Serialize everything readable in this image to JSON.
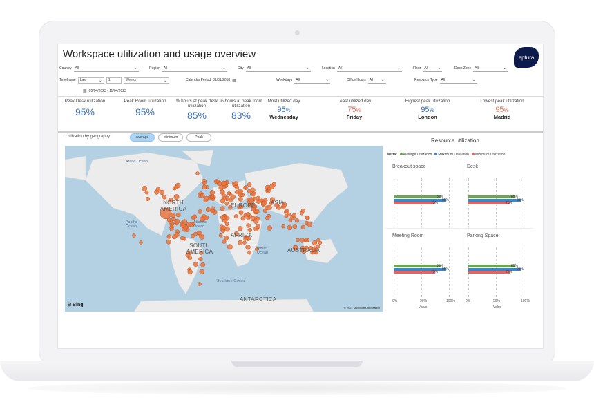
{
  "report": {
    "title": "Workspace utilization and usage overview",
    "logo_text": "eptura"
  },
  "filters": {
    "country": {
      "label": "Country",
      "value": "All"
    },
    "region": {
      "label": "Region",
      "value": "All"
    },
    "city": {
      "label": "City",
      "value": "All"
    },
    "location": {
      "label": "Location",
      "value": "All"
    },
    "floor": {
      "label": "Floor",
      "value": "All"
    },
    "desk_zone": {
      "label": "Desk Zone",
      "value": "All"
    },
    "timeframe": {
      "label": "Timeframe",
      "mode": "Last",
      "count": "1",
      "unit": "Weeks"
    },
    "calendar_period": {
      "label": "Calendar Period",
      "value": "01/01/2018"
    },
    "weekdays": {
      "label": "Weekdays",
      "value": "All"
    },
    "office_hours": {
      "label": "Office Hours",
      "value": "All"
    },
    "resource_type": {
      "label": "Resource Type",
      "value": "All"
    },
    "date_range": "05/04/2023 - 11/04/2023"
  },
  "kpis": [
    {
      "label": "Peak Desk utilization",
      "value": "95%"
    },
    {
      "label": "Peak Room utilization",
      "value": "95%"
    },
    {
      "label": "% hours at peak desk utilization",
      "value": "85%"
    },
    {
      "label": "% hours at peak room utilization",
      "value": "83%"
    },
    {
      "label": "Most utilized day",
      "value": "95",
      "unit": "%",
      "sub": "Wednesday"
    },
    {
      "label": "Least utilized day",
      "value": "75",
      "unit": "%",
      "sub": "Friday"
    },
    {
      "label": "Highest peak utilization",
      "value": "95",
      "unit": "%",
      "sub": "London"
    },
    {
      "label": "Lowest peak utilization",
      "value": "95",
      "unit": "%",
      "sub": "Madrid"
    }
  ],
  "geography": {
    "label": "Utilization by geography:",
    "toggles": [
      "Average",
      "Minimum",
      "Peak"
    ],
    "active": "Average"
  },
  "map": {
    "labels": {
      "arctic": "Arctic Ocean",
      "north_america": "NORTH AMERICA",
      "europe": "EUROPE",
      "asia": "ASIA",
      "africa": "AFRICA",
      "south_america": "SOUTH AMERICA",
      "australia": "AUSTRALIA",
      "antarctica": "ANTARCTICA",
      "atlantic": "Atlantic Ocean",
      "pacific": "Pacific Ocean",
      "indian": "Indian Ocean",
      "southern": "Southern Ocean"
    },
    "bing": "Bing",
    "copyright": "© 2021 Microsoft Corporation",
    "point_color": "#e8763f"
  },
  "resource_utilization": {
    "title": "Resource utilization",
    "legend_title": "Metric",
    "legend": [
      {
        "name": "Average Utilization",
        "color": "#6aa84f"
      },
      {
        "name": "Maximum Utilization",
        "color": "#3d85c6"
      },
      {
        "name": "Minimum Utilization",
        "color": "#e06666"
      }
    ],
    "axis_label": "Value",
    "ticks": [
      "0%",
      "50%",
      "100%"
    ],
    "panels": [
      {
        "name": "Breakout space",
        "values": [
          85,
          95,
          75
        ]
      },
      {
        "name": "Desk",
        "values": [
          85,
          95,
          75
        ]
      },
      {
        "name": "Meeting Room",
        "values": [
          85,
          95,
          75
        ]
      },
      {
        "name": "Parking Space",
        "values": [
          85,
          95,
          75
        ]
      }
    ]
  }
}
